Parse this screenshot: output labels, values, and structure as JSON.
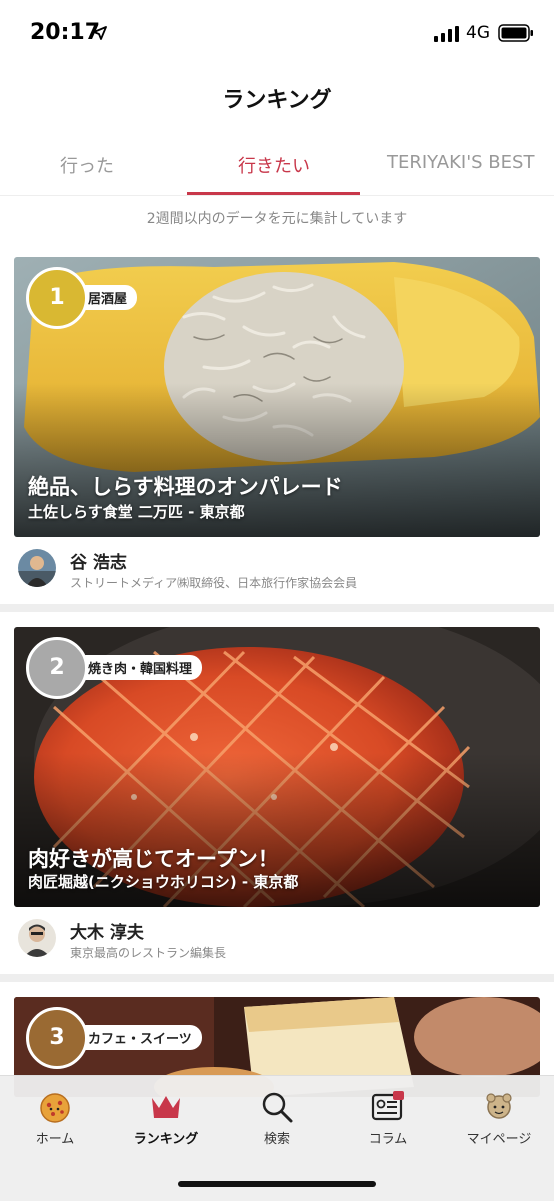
{
  "status_bar": {
    "time": "20:17",
    "network": "4G"
  },
  "header": {
    "title": "ランキング"
  },
  "tabs": [
    {
      "label": "行った"
    },
    {
      "label": "行きたい"
    },
    {
      "label": "TERIYAKI'S BEST"
    }
  ],
  "active_tab": "行きたい",
  "note": "2週間以内のデータを元に集計しています",
  "cards": [
    {
      "rank": "1",
      "category": "居酒屋",
      "title": "絶品、しらす料理のオンパレード",
      "subtitle": "土佐しらす食堂 二万匹 - 東京都",
      "author_name": "谷 浩志",
      "author_role": "ストリートメディア㈱取締役、日本旅行作家協会会員",
      "badge_color": "#d9b832"
    },
    {
      "rank": "2",
      "category": "焼き肉・韓国料理",
      "title": "肉好きが高じてオープン！",
      "subtitle": "肉匠堀越(ニクショウホリコシ) - 東京都",
      "author_name": "大木 淳夫",
      "author_role": "東京最高のレストラン編集長",
      "badge_color": "#a9a9a9"
    },
    {
      "rank": "3",
      "category": "カフェ・スイーツ",
      "badge_color": "#9a6a33"
    }
  ],
  "tabbar": [
    {
      "label": "ホーム",
      "icon": "home-mascot-icon"
    },
    {
      "label": "ランキング",
      "icon": "crown-icon"
    },
    {
      "label": "検索",
      "icon": "search-icon"
    },
    {
      "label": "コラム",
      "icon": "column-icon"
    },
    {
      "label": "マイページ",
      "icon": "mypage-mascot-icon"
    }
  ],
  "colors": {
    "accent": "#c8374a",
    "gold": "#d9b832",
    "silver": "#a9a9a9",
    "bronze": "#9a6a33"
  }
}
